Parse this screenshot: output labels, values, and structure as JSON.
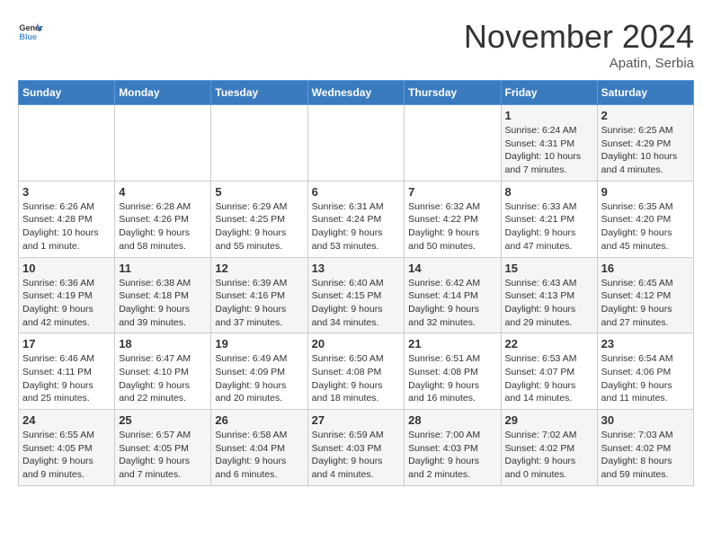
{
  "header": {
    "logo_general": "General",
    "logo_blue": "Blue",
    "month_title": "November 2024",
    "location": "Apatin, Serbia"
  },
  "weekdays": [
    "Sunday",
    "Monday",
    "Tuesday",
    "Wednesday",
    "Thursday",
    "Friday",
    "Saturday"
  ],
  "weeks": [
    [
      {
        "day": "",
        "info": ""
      },
      {
        "day": "",
        "info": ""
      },
      {
        "day": "",
        "info": ""
      },
      {
        "day": "",
        "info": ""
      },
      {
        "day": "",
        "info": ""
      },
      {
        "day": "1",
        "info": "Sunrise: 6:24 AM\nSunset: 4:31 PM\nDaylight: 10 hours and 7 minutes."
      },
      {
        "day": "2",
        "info": "Sunrise: 6:25 AM\nSunset: 4:29 PM\nDaylight: 10 hours and 4 minutes."
      }
    ],
    [
      {
        "day": "3",
        "info": "Sunrise: 6:26 AM\nSunset: 4:28 PM\nDaylight: 10 hours and 1 minute."
      },
      {
        "day": "4",
        "info": "Sunrise: 6:28 AM\nSunset: 4:26 PM\nDaylight: 9 hours and 58 minutes."
      },
      {
        "day": "5",
        "info": "Sunrise: 6:29 AM\nSunset: 4:25 PM\nDaylight: 9 hours and 55 minutes."
      },
      {
        "day": "6",
        "info": "Sunrise: 6:31 AM\nSunset: 4:24 PM\nDaylight: 9 hours and 53 minutes."
      },
      {
        "day": "7",
        "info": "Sunrise: 6:32 AM\nSunset: 4:22 PM\nDaylight: 9 hours and 50 minutes."
      },
      {
        "day": "8",
        "info": "Sunrise: 6:33 AM\nSunset: 4:21 PM\nDaylight: 9 hours and 47 minutes."
      },
      {
        "day": "9",
        "info": "Sunrise: 6:35 AM\nSunset: 4:20 PM\nDaylight: 9 hours and 45 minutes."
      }
    ],
    [
      {
        "day": "10",
        "info": "Sunrise: 6:36 AM\nSunset: 4:19 PM\nDaylight: 9 hours and 42 minutes."
      },
      {
        "day": "11",
        "info": "Sunrise: 6:38 AM\nSunset: 4:18 PM\nDaylight: 9 hours and 39 minutes."
      },
      {
        "day": "12",
        "info": "Sunrise: 6:39 AM\nSunset: 4:16 PM\nDaylight: 9 hours and 37 minutes."
      },
      {
        "day": "13",
        "info": "Sunrise: 6:40 AM\nSunset: 4:15 PM\nDaylight: 9 hours and 34 minutes."
      },
      {
        "day": "14",
        "info": "Sunrise: 6:42 AM\nSunset: 4:14 PM\nDaylight: 9 hours and 32 minutes."
      },
      {
        "day": "15",
        "info": "Sunrise: 6:43 AM\nSunset: 4:13 PM\nDaylight: 9 hours and 29 minutes."
      },
      {
        "day": "16",
        "info": "Sunrise: 6:45 AM\nSunset: 4:12 PM\nDaylight: 9 hours and 27 minutes."
      }
    ],
    [
      {
        "day": "17",
        "info": "Sunrise: 6:46 AM\nSunset: 4:11 PM\nDaylight: 9 hours and 25 minutes."
      },
      {
        "day": "18",
        "info": "Sunrise: 6:47 AM\nSunset: 4:10 PM\nDaylight: 9 hours and 22 minutes."
      },
      {
        "day": "19",
        "info": "Sunrise: 6:49 AM\nSunset: 4:09 PM\nDaylight: 9 hours and 20 minutes."
      },
      {
        "day": "20",
        "info": "Sunrise: 6:50 AM\nSunset: 4:08 PM\nDaylight: 9 hours and 18 minutes."
      },
      {
        "day": "21",
        "info": "Sunrise: 6:51 AM\nSunset: 4:08 PM\nDaylight: 9 hours and 16 minutes."
      },
      {
        "day": "22",
        "info": "Sunrise: 6:53 AM\nSunset: 4:07 PM\nDaylight: 9 hours and 14 minutes."
      },
      {
        "day": "23",
        "info": "Sunrise: 6:54 AM\nSunset: 4:06 PM\nDaylight: 9 hours and 11 minutes."
      }
    ],
    [
      {
        "day": "24",
        "info": "Sunrise: 6:55 AM\nSunset: 4:05 PM\nDaylight: 9 hours and 9 minutes."
      },
      {
        "day": "25",
        "info": "Sunrise: 6:57 AM\nSunset: 4:05 PM\nDaylight: 9 hours and 7 minutes."
      },
      {
        "day": "26",
        "info": "Sunrise: 6:58 AM\nSunset: 4:04 PM\nDaylight: 9 hours and 6 minutes."
      },
      {
        "day": "27",
        "info": "Sunrise: 6:59 AM\nSunset: 4:03 PM\nDaylight: 9 hours and 4 minutes."
      },
      {
        "day": "28",
        "info": "Sunrise: 7:00 AM\nSunset: 4:03 PM\nDaylight: 9 hours and 2 minutes."
      },
      {
        "day": "29",
        "info": "Sunrise: 7:02 AM\nSunset: 4:02 PM\nDaylight: 9 hours and 0 minutes."
      },
      {
        "day": "30",
        "info": "Sunrise: 7:03 AM\nSunset: 4:02 PM\nDaylight: 8 hours and 59 minutes."
      }
    ]
  ]
}
